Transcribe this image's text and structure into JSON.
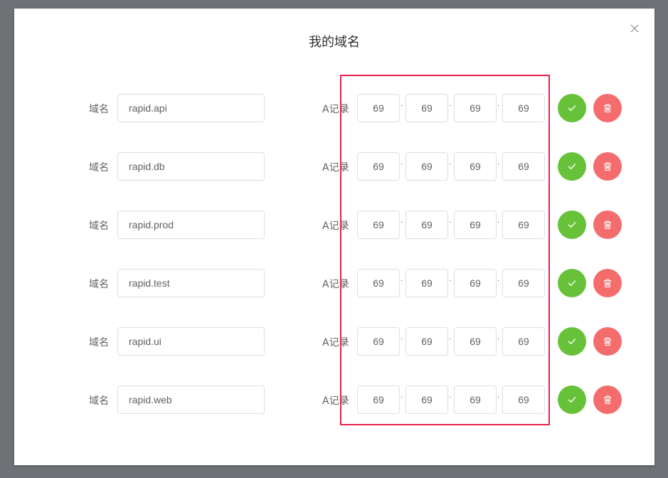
{
  "dialog": {
    "title": "我的域名",
    "close_icon": "close-icon"
  },
  "labels": {
    "domain": "域名",
    "a_record": "A记录",
    "ip_separator": "."
  },
  "colors": {
    "confirm": "#67c23a",
    "delete": "#f56c6c",
    "highlight": "#e8214a"
  },
  "rows": [
    {
      "domain": "rapid.api",
      "ip": [
        "69",
        "69",
        "69",
        "69"
      ]
    },
    {
      "domain": "rapid.db",
      "ip": [
        "69",
        "69",
        "69",
        "69"
      ]
    },
    {
      "domain": "rapid.prod",
      "ip": [
        "69",
        "69",
        "69",
        "69"
      ]
    },
    {
      "domain": "rapid.test",
      "ip": [
        "69",
        "69",
        "69",
        "69"
      ]
    },
    {
      "domain": "rapid.ui",
      "ip": [
        "69",
        "69",
        "69",
        "69"
      ]
    },
    {
      "domain": "rapid.web",
      "ip": [
        "69",
        "69",
        "69",
        "69"
      ]
    }
  ]
}
